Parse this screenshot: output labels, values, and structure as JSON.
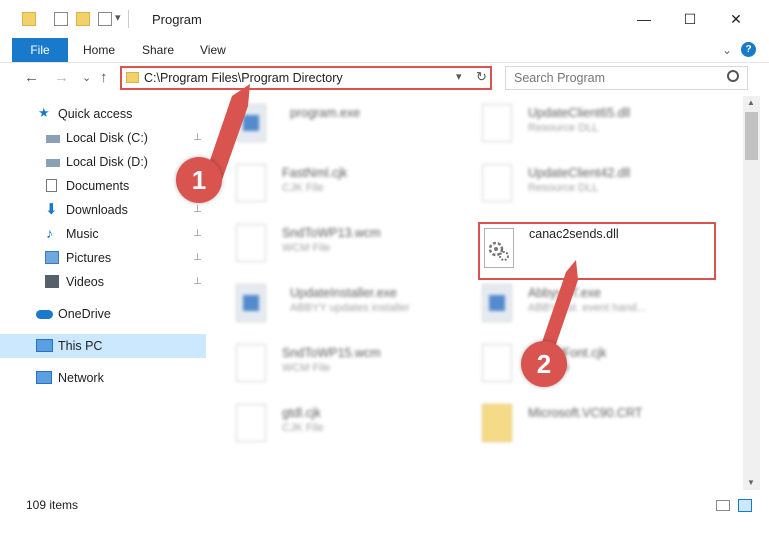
{
  "window": {
    "title": "Program",
    "minimize_glyph": "—",
    "maximize_glyph": "☐",
    "close_glyph": "✕",
    "dropdown_glyph": "▾"
  },
  "ribbon": {
    "file": "File",
    "home": "Home",
    "share": "Share",
    "view": "View",
    "collapse_glyph": "⌄",
    "help_glyph": "?"
  },
  "nav": {
    "back": "←",
    "forward": "→",
    "recent": "⌄",
    "up": "↑",
    "refresh": "↻",
    "address": "C:\\Program Files\\Program Directory",
    "search_placeholder": "Search Program"
  },
  "sidebar": {
    "items": [
      {
        "label": "Quick access",
        "pinned": false
      },
      {
        "label": "Local Disk (C:)",
        "pinned": true
      },
      {
        "label": "Local Disk (D:)",
        "pinned": true
      },
      {
        "label": "Documents",
        "pinned": true
      },
      {
        "label": "Downloads",
        "pinned": true
      },
      {
        "label": "Music",
        "pinned": true
      },
      {
        "label": "Pictures",
        "pinned": true
      },
      {
        "label": "Videos",
        "pinned": true
      },
      {
        "label": "OneDrive",
        "pinned": false
      },
      {
        "label": "This PC",
        "pinned": false
      },
      {
        "label": "Network",
        "pinned": false
      }
    ],
    "pin_glyph": "📌"
  },
  "files": [
    {
      "name": "program.exe",
      "type": ""
    },
    {
      "name": "UpdateClient65.dll",
      "type": "Resource DLL"
    },
    {
      "name": "FastNml.cjk",
      "type": "CJK File"
    },
    {
      "name": "UpdateClient42.dll",
      "type": "Resource DLL"
    },
    {
      "name": "SndToWP13.wcm",
      "type": "WCM File"
    },
    {
      "name": "canac2sends.dll",
      "type": ""
    },
    {
      "name": "UpdateInstaller.exe",
      "type": "ABBYY updates installer"
    },
    {
      "name": "AbbyyST.exe",
      "type": "ABBYY st. event hand..."
    },
    {
      "name": "SndToWP15.wcm",
      "type": "WCM File"
    },
    {
      "name": "AbbyyFont.cjk",
      "type": "CJK File"
    },
    {
      "name": "gtdl.cjk",
      "type": "CJK File"
    },
    {
      "name": "Microsoft.VC90.CRT",
      "type": ""
    }
  ],
  "status": {
    "count": "109 items"
  },
  "annotations": {
    "step1": "1",
    "step2": "2",
    "accent": "#d9534f"
  }
}
